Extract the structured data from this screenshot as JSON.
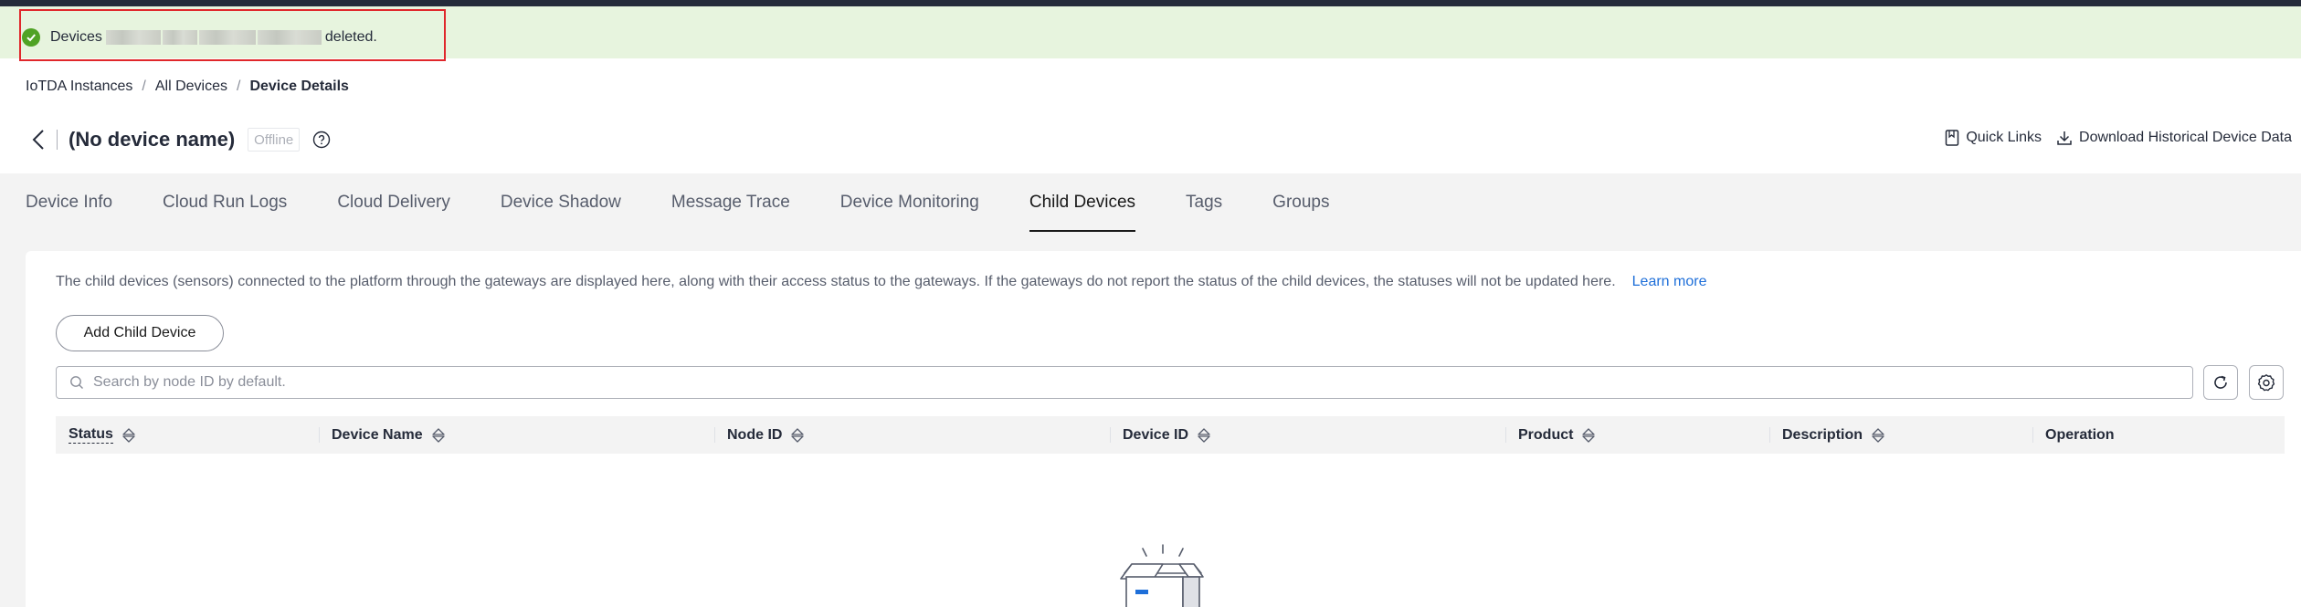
{
  "toast": {
    "prefix": "Devices",
    "suffix": "deleted.",
    "icon": "success-check-icon",
    "color": "#50a225"
  },
  "breadcrumb": {
    "items": [
      "IoTDA Instances",
      "All Devices"
    ],
    "current": "Device Details",
    "separator": "/"
  },
  "device": {
    "title": "(No device name)",
    "status": "Offline"
  },
  "header_actions": {
    "quick_links": "Quick Links",
    "download": "Download Historical Device Data"
  },
  "tabs": [
    {
      "label": "Device Info"
    },
    {
      "label": "Cloud Run Logs"
    },
    {
      "label": "Cloud Delivery"
    },
    {
      "label": "Device Shadow"
    },
    {
      "label": "Message Trace"
    },
    {
      "label": "Device Monitoring"
    },
    {
      "label": "Child Devices",
      "active": true
    },
    {
      "label": "Tags"
    },
    {
      "label": "Groups"
    }
  ],
  "child_devices": {
    "intro": "The child devices (sensors) connected to the platform through the gateways are displayed here, along with their access status to the gateways. If the gateways do not report the status of the child devices, the statuses will not be updated here.",
    "learn_more": "Learn more",
    "add_button": "Add Child Device",
    "search_placeholder": "Search by node ID by default.",
    "columns": [
      "Status",
      "Device Name",
      "Node ID",
      "Device ID",
      "Product",
      "Description",
      "Operation"
    ]
  },
  "colors": {
    "link": "#1e6fd9",
    "toast_bg": "#e7f4de",
    "highlight_border": "#e0272b"
  }
}
